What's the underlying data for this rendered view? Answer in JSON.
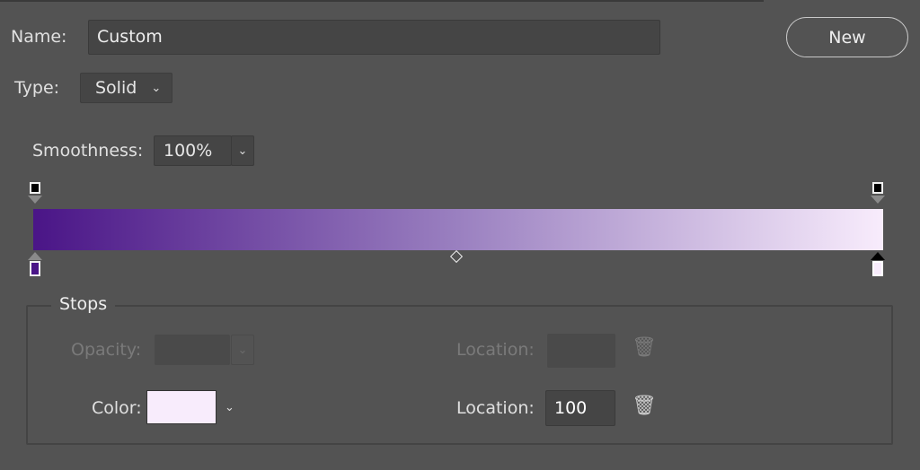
{
  "name": {
    "label": "Name:",
    "value": "Custom"
  },
  "new_button": "New",
  "type": {
    "label": "Type:",
    "value": "Solid"
  },
  "smoothness": {
    "label": "Smoothness:",
    "value": "100%"
  },
  "gradient": {
    "colors": [
      "#4a1587",
      "#9a80c0",
      "#f8ecfc"
    ],
    "opacity_stops": [
      {
        "location": 0,
        "color": "#000000"
      },
      {
        "location": 100,
        "color": "#000000"
      }
    ],
    "color_stops": [
      {
        "location": 0,
        "color": "#4a1587"
      },
      {
        "location": 100,
        "color": "#f8ecfc",
        "selected": true
      }
    ],
    "midpoint": 50
  },
  "stops": {
    "title": "Stops",
    "opacity_label": "Opacity:",
    "opacity_location_label": "Location:",
    "color_label": "Color:",
    "color_value": "#f8ecfc",
    "color_location_label": "Location:",
    "color_location_value": "100"
  }
}
